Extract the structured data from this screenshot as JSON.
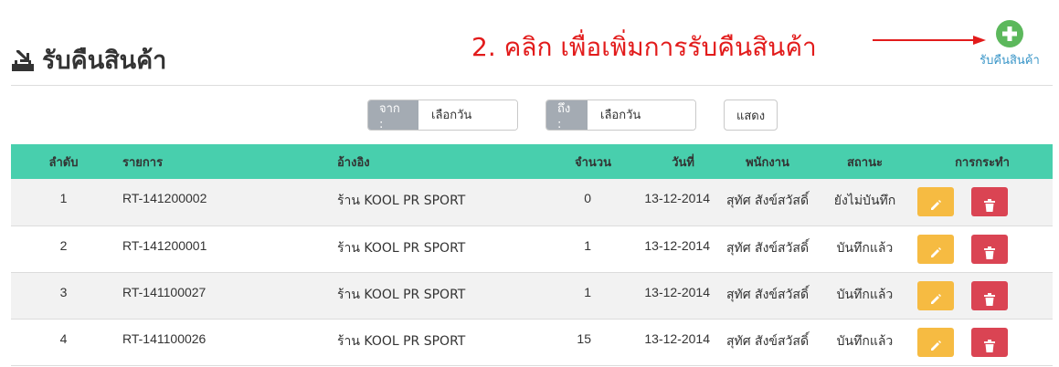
{
  "header": {
    "title": "รับคืนสินค้า",
    "title_icon": "inbox-download-icon",
    "annotation": "2. คลิก เพื่อเพิ่มการรับคืนสินค้า",
    "add_button": {
      "icon": "plus-circle-icon",
      "label": "รับคืนสินค้า"
    }
  },
  "filters": {
    "from": {
      "label": "จาก :",
      "placeholder": "เลือกวัน"
    },
    "to": {
      "label": "ถึง :",
      "placeholder": "เลือกวัน"
    },
    "show_label": "แสดง"
  },
  "table": {
    "columns": [
      "ลำดับ",
      "รายการ",
      "อ้างอิง",
      "จำนวน",
      "วันที่",
      "พนักงาน",
      "สถานะ",
      "การกระทำ"
    ],
    "rows": [
      {
        "no": "1",
        "item": "RT-141200002",
        "ref": "ร้าน KOOL PR SPORT",
        "qty": "0",
        "date": "13-12-2014",
        "staff": "สุทัศ สังข์สวัสดิ์",
        "status": "ยังไม่บันทึก"
      },
      {
        "no": "2",
        "item": "RT-141200001",
        "ref": "ร้าน KOOL PR SPORT",
        "qty": "1",
        "date": "13-12-2014",
        "staff": "สุทัศ สังข์สวัสดิ์",
        "status": "บันทึกแล้ว"
      },
      {
        "no": "3",
        "item": "RT-141100027",
        "ref": "ร้าน KOOL PR SPORT",
        "qty": "1",
        "date": "13-12-2014",
        "staff": "สุทัศ สังข์สวัสดิ์",
        "status": "บันทึกแล้ว"
      },
      {
        "no": "4",
        "item": "RT-141100026",
        "ref": "ร้าน KOOL PR SPORT",
        "qty": "15",
        "date": "13-12-2014",
        "staff": "สุทัศ สังข์สวัสดิ์",
        "status": "บันทึกแล้ว"
      }
    ],
    "actions": {
      "edit_icon": "pencil-icon",
      "delete_icon": "trash-icon"
    }
  },
  "colors": {
    "table_header": "#48cfad",
    "edit_button": "#f6bb42",
    "delete_button": "#da4453",
    "add_icon": "#5cb85c",
    "annotation": "#e21b1b",
    "link": "#3a96c8"
  }
}
